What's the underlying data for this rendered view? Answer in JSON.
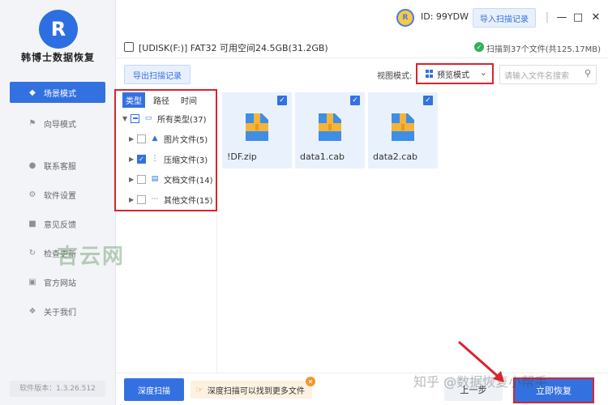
{
  "app": {
    "name": "韩博士数据恢复",
    "version": "软件版本：1.3.26.512"
  },
  "sidebar": {
    "items": [
      {
        "label": "场景模式",
        "icon": "scenes-icon",
        "active": true
      },
      {
        "label": "向导模式",
        "icon": "flag-icon"
      },
      {
        "label": "联系客服",
        "icon": "headset-icon"
      },
      {
        "label": "软件设置",
        "icon": "gear-icon"
      },
      {
        "label": "意见反馈",
        "icon": "feedback-icon"
      },
      {
        "label": "检查更新",
        "icon": "update-icon"
      },
      {
        "label": "官方网站",
        "icon": "website-icon"
      },
      {
        "label": "关于我们",
        "icon": "about-icon"
      }
    ]
  },
  "header": {
    "user_id": "ID: 99YDW",
    "import_label": "导入扫描记录"
  },
  "drive": {
    "info": "[UDISK(F:)] FAT32 可用空间24.5GB(31.2GB)",
    "scan_status": "扫描到37个文件(共125.17MB)"
  },
  "toolbar": {
    "export_label": "导出扫描记录",
    "view_label": "视图模式:",
    "view_value": "预览模式",
    "search_placeholder": "请输入文件名搜索"
  },
  "tree": {
    "tabs": [
      "类型",
      "路径",
      "时间"
    ],
    "root": "所有类型(37)",
    "items": [
      {
        "label": "图片文件(5)",
        "checked": false,
        "icon": "image-icon"
      },
      {
        "label": "压缩文件(3)",
        "checked": true,
        "icon": "archive-icon"
      },
      {
        "label": "文档文件(14)",
        "checked": false,
        "icon": "document-icon"
      },
      {
        "label": "其他文件(15)",
        "checked": false,
        "icon": "more-icon"
      }
    ]
  },
  "files": [
    {
      "name": "!DF.zip"
    },
    {
      "name": "data1.cab"
    },
    {
      "name": "data2.cab"
    }
  ],
  "bottom": {
    "deep_scan_label": "深度扫描",
    "deep_scan_tip": "深度扫描可以找到更多文件",
    "prev_label": "上一步",
    "recover_label": "立即恢复"
  },
  "watermarks": {
    "left": "吉云网",
    "right": "知乎 @数据恢复小帮手"
  },
  "colors": {
    "accent": "#3471e0",
    "highlight": "#d9242c"
  }
}
